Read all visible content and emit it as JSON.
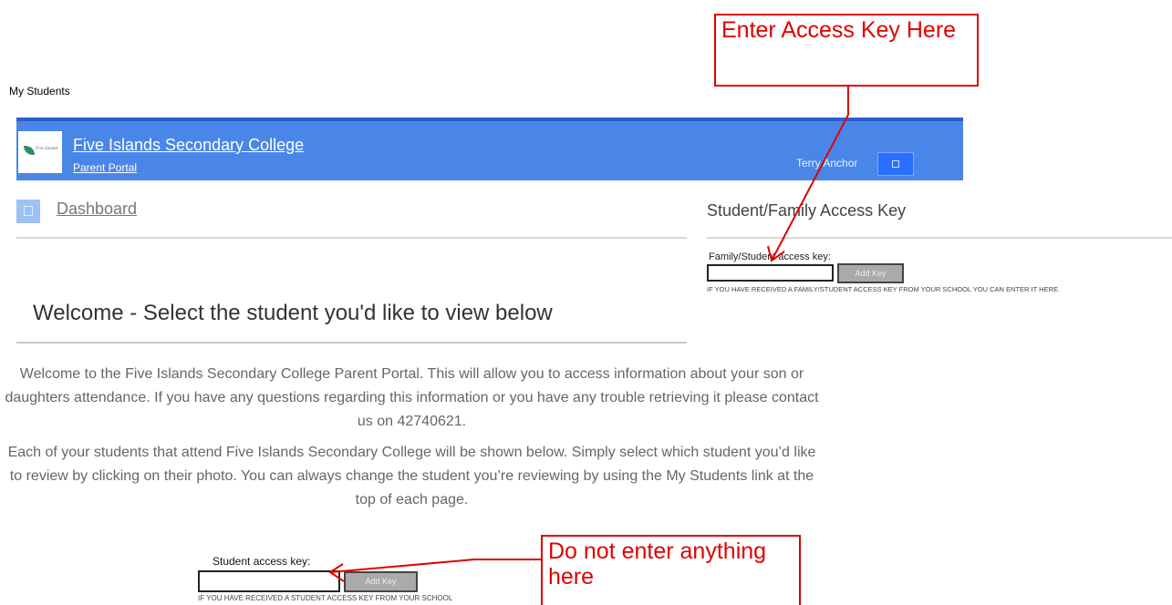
{
  "page": {
    "nav_label": "My Students"
  },
  "header": {
    "school_name": "Five Islands Secondary College",
    "portal_label": "Parent Portal",
    "user_name": "Terry Anchor",
    "logo_text": "Five Islands"
  },
  "nav": {
    "dashboard_label": "Dashboard"
  },
  "access_key_panel": {
    "heading": "Student/Family Access Key",
    "field_label": "Family/Student access key:",
    "field_value": "",
    "button_label": "Add Key",
    "note": "IF YOU HAVE RECEIVED A FAMILY/STUDENT ACCESS KEY FROM YOUR SCHOOL YOU CAN ENTER IT HERE."
  },
  "welcome": {
    "heading": "Welcome - Select the student you'd like to view below",
    "paragraph1": "Welcome to the Five Islands Secondary College Parent Portal. This will allow you to access information about your son or daughters attendance. If you have any questions regarding this information or you have any trouble retrieving it please contact us on 42740621.",
    "paragraph2": "Each of your students that attend Five Islands Secondary College will be shown below. Simply select which student you’d like to review by clicking on their photo. You can always change the student you’re reviewing by using the My Students link at the top of each page."
  },
  "student_key": {
    "field_label": "Student access key:",
    "field_value": "",
    "button_label": "Add Key",
    "note": "IF YOU HAVE RECEIVED A STUDENT ACCESS KEY FROM YOUR SCHOOL"
  },
  "annotations": {
    "top_callout": "Enter Access Key Here",
    "bottom_callout": "Do not enter anything here",
    "color": "#e00000"
  },
  "colors": {
    "header_bg": "#4a86e8",
    "accent": "#2a6fff"
  }
}
